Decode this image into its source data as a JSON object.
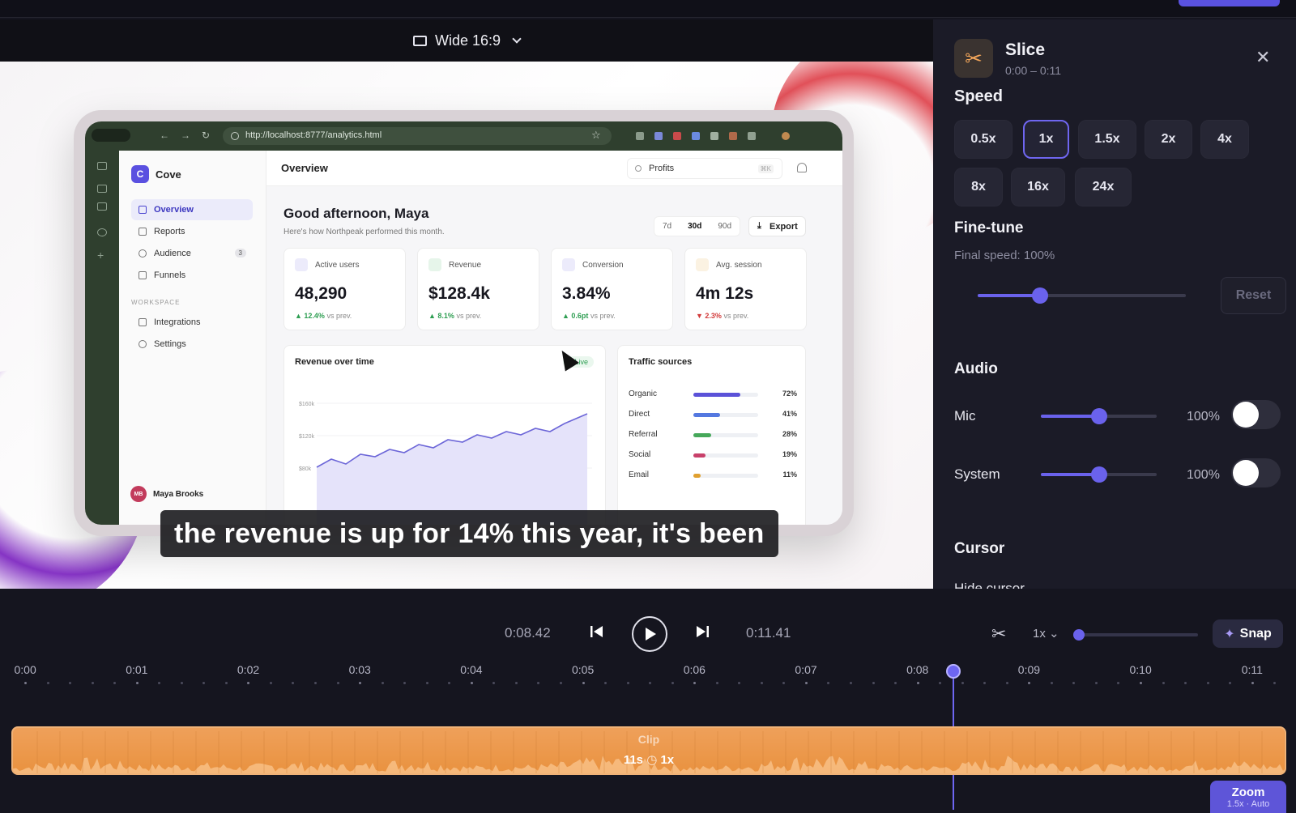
{
  "stage": {
    "aspect_label": "Wide 16:9"
  },
  "recording": {
    "url": "http://localhost:8777/analytics.html",
    "app": {
      "brand": "Cove",
      "nav": [
        {
          "label": "Overview",
          "active": true
        },
        {
          "label": "Reports"
        },
        {
          "label": "Audience",
          "badge": "3"
        },
        {
          "label": "Funnels"
        }
      ],
      "workspace_label": "WORKSPACE",
      "workspace_nav": [
        {
          "label": "Integrations"
        },
        {
          "label": "Settings"
        }
      ],
      "user": {
        "initials": "MB",
        "name": "Maya Brooks"
      },
      "page_title": "Overview",
      "search_value": "Profits",
      "search_kbd": "⌘K",
      "greeting": "Good afternoon, Maya",
      "greeting_sub": "Here's how Northpeak performed this month.",
      "ranges": [
        "7d",
        "30d",
        "90d"
      ],
      "range_selected": "30d",
      "export_label": "Export",
      "kpis": [
        {
          "label": "Active users",
          "value": "48,290",
          "delta": "▲ 12.4%",
          "delta_dir": "up",
          "suffix": "vs prev.",
          "color": "#6c66e8"
        },
        {
          "label": "Revenue",
          "value": "$128.4k",
          "delta": "▲ 8.1%",
          "delta_dir": "up",
          "suffix": "vs prev.",
          "color": "#2e9e52"
        },
        {
          "label": "Conversion",
          "value": "3.84%",
          "delta": "▲ 0.6pt",
          "delta_dir": "up",
          "suffix": "vs prev.",
          "color": "#6c66e8"
        },
        {
          "label": "Avg. session",
          "value": "4m 12s",
          "delta": "▼ 2.3%",
          "delta_dir": "down",
          "suffix": "vs prev.",
          "color": "#e0a030"
        }
      ],
      "revenue_card": {
        "title": "Revenue over time",
        "live_label": "● Live",
        "y_ticks": [
          "$160k",
          "$120k",
          "$80k"
        ]
      },
      "traffic_card": {
        "title": "Traffic sources",
        "rows": [
          {
            "label": "Organic",
            "pct": "72%",
            "value": 72,
            "color": "#5b52d8"
          },
          {
            "label": "Direct",
            "pct": "41%",
            "value": 41,
            "color": "#5478e0"
          },
          {
            "label": "Referral",
            "pct": "28%",
            "value": 28,
            "color": "#46a85a"
          },
          {
            "label": "Social",
            "pct": "19%",
            "value": 19,
            "color": "#c8406a"
          },
          {
            "label": "Email",
            "pct": "11%",
            "value": 11,
            "color": "#e0a030"
          }
        ]
      }
    },
    "caption": "the revenue is up for 14% this year, it's been"
  },
  "panel": {
    "title": "Slice",
    "range": "0:00 – 0:11",
    "close_icon": "close-icon",
    "speed_heading": "Speed",
    "speed_options": [
      "0.5x",
      "1x",
      "1.5x",
      "2x",
      "4x",
      "8x",
      "16x",
      "24x"
    ],
    "speed_selected": "1x",
    "finetune_heading": "Fine-tune",
    "finetune_sub": "Final speed: 100%",
    "finetune_level": 0.3,
    "reset_label": "Reset",
    "audio_heading": "Audio",
    "audio": [
      {
        "label": "Mic",
        "value": "100%",
        "level": 0.5,
        "enabled": false
      },
      {
        "label": "System",
        "value": "100%",
        "level": 0.5,
        "enabled": false
      }
    ],
    "cursor_heading": "Cursor",
    "hide_cursor_label": "Hide cursor"
  },
  "transport": {
    "current_time": "0:08.42",
    "total_time": "0:11.41",
    "zoom_level": "1x",
    "zoom_slider": 0.0,
    "snap_label": "Snap"
  },
  "timeline": {
    "ticks": [
      "0:00",
      "0:01",
      "0:02",
      "0:03",
      "0:04",
      "0:05",
      "0:06",
      "0:07",
      "0:08",
      "0:09",
      "0:10",
      "0:11"
    ],
    "playhead_seconds": 8.42,
    "clip": {
      "name": "Clip",
      "duration": "11s",
      "speed": "1x",
      "color": "#e9963f"
    },
    "zoom_chip": {
      "label": "Zoom",
      "sub": "1.5x · Auto"
    }
  }
}
